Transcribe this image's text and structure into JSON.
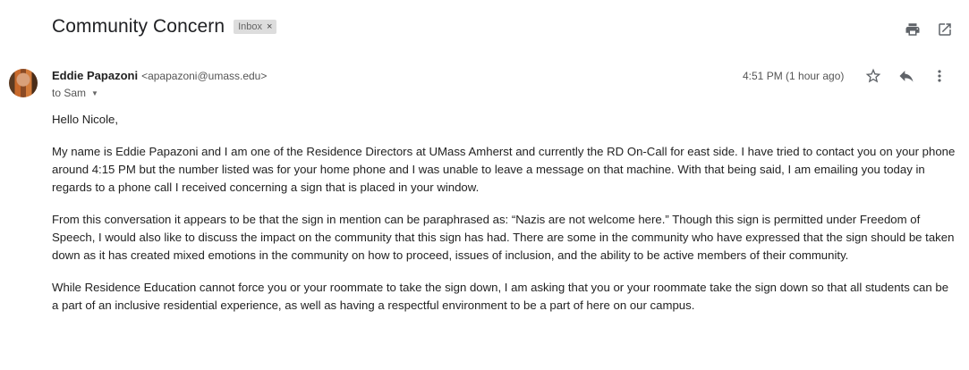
{
  "email": {
    "subject": "Community Concern",
    "label": "Inbox",
    "label_close": "×",
    "sender_name": "Eddie Papazoni",
    "sender_email": "<apapazoni@umass.edu>",
    "recipient": "to Sam",
    "time": "4:51 PM (1 hour ago)",
    "greeting": "Hello Nicole,",
    "paragraphs": [
      "My name is Eddie Papazoni and I am one of the Residence Directors at UMass Amherst and currently the RD On-Call for east side.  I have tried to contact you on your phone around 4:15 PM but the number listed was for your home phone and I was unable to leave a message on that machine.  With that being said, I am emailing you today in regards to a phone call I received concerning a sign that is placed in your window.",
      "From this conversation it appears to be that the sign in mention can be paraphrased as: “Nazis are not welcome here.”  Though this sign is permitted under Freedom of Speech, I would also like to discuss the impact on the community that this sign has had.  There are some in the community who have expressed that the sign should be taken down as it has created mixed emotions in the community on how to proceed, issues of inclusion,  and the ability to be active members of their community.",
      "While Residence Education cannot force you or your roommate to take the sign down, I am asking that you or your roommate take the sign down so that all students can be a part of an inclusive residential experience, as well as having a respectful environment to be a part of here on our campus."
    ]
  },
  "icons": {
    "print": "print-icon",
    "open_new_window": "open-in-new-window-icon",
    "star": "star-icon",
    "reply": "reply-icon",
    "more": "more-vertical-icon",
    "caret": "chevron-down-icon"
  },
  "colors": {
    "text": "#222222",
    "muted": "#555555",
    "chip_bg": "#dddddd"
  }
}
